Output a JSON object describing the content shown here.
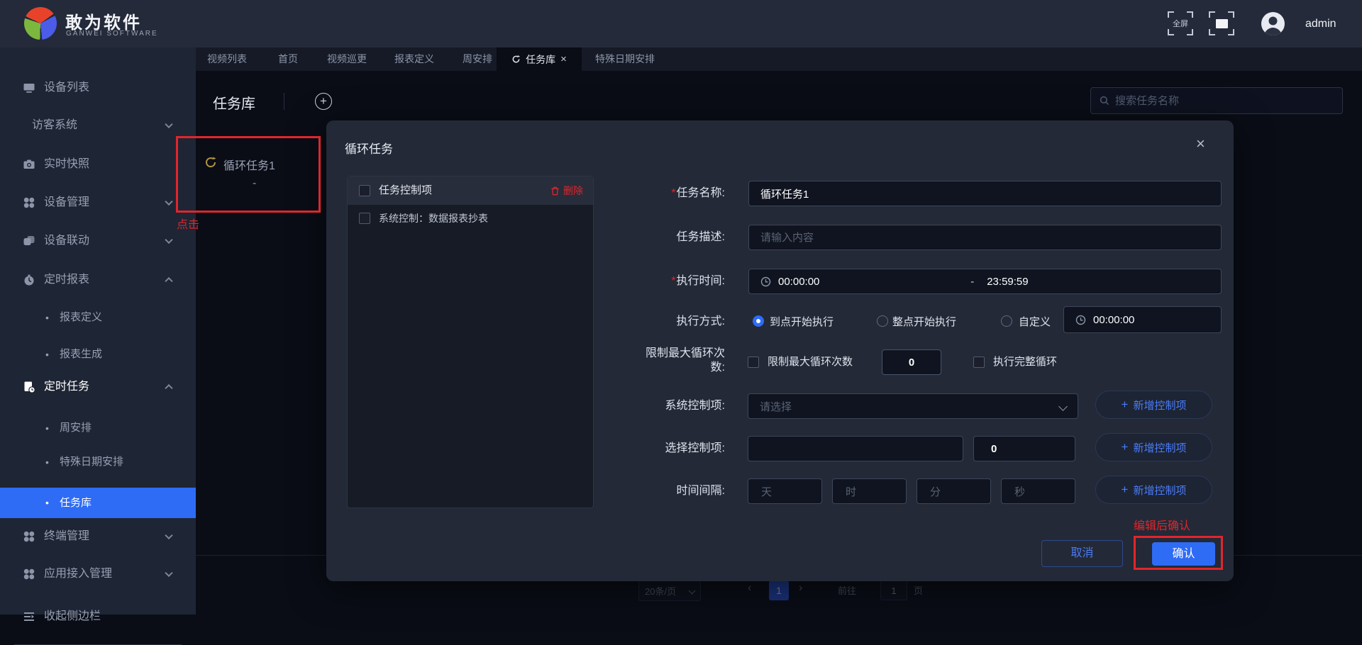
{
  "colors": {
    "accent_blue": "#2e6cf6",
    "alert_red": "#e0262c",
    "link_blue": "#4a7cf7",
    "loop_icon_yellow": "#b3953f"
  },
  "icons": {
    "plus": "+",
    "close": "×",
    "required": "*",
    "bullet": "•",
    "range_sep": "-",
    "prev": "‹",
    "next": "›"
  },
  "header": {
    "brand": "敢为软件",
    "brand_sub": "GANWEI  SOFTWARE",
    "fullscreen_label": "全屏",
    "username": "admin"
  },
  "tabs": [
    {
      "label": "视频列表"
    },
    {
      "label": "首页"
    },
    {
      "label": "视频巡更"
    },
    {
      "label": "报表定义"
    },
    {
      "label": "周安排"
    },
    {
      "label": "任务库",
      "active": true
    },
    {
      "label": "特殊日期安排"
    }
  ],
  "sidebar": {
    "items": [
      {
        "label": "设备列表"
      },
      {
        "label": "访客系统"
      },
      {
        "label": "实时快照"
      },
      {
        "label": "设备管理"
      },
      {
        "label": "设备联动"
      },
      {
        "label": "定时报表"
      },
      {
        "label": "报表定义"
      },
      {
        "label": "报表生成"
      },
      {
        "label": "定时任务"
      },
      {
        "label": "周安排"
      },
      {
        "label": "特殊日期安排"
      },
      {
        "label": "任务库",
        "selected": true
      },
      {
        "label": "终端管理"
      },
      {
        "label": "应用接入管理"
      }
    ],
    "collapse_label": "收起侧边栏"
  },
  "page": {
    "title": "任务库",
    "search_placeholder": "搜索任务名称"
  },
  "task_list": {
    "item_name": "循环任务1",
    "item_sub": "-",
    "annotation": "点击"
  },
  "dialog": {
    "title": "循环任务",
    "panel": {
      "header": "任务控制项",
      "delete_label": "删除",
      "row": "系统控制：数据报表抄表"
    },
    "form": {
      "task_name": {
        "label": "任务名称:",
        "value": "循环任务1"
      },
      "task_desc": {
        "label": "任务描述:",
        "placeholder": "请输入内容"
      },
      "exec_time": {
        "label": "执行时间:",
        "start": "00:00:00",
        "end": "23:59:59"
      },
      "exec_mode": {
        "label": "执行方式:",
        "option1": "到点开始执行",
        "option2": "整点开始执行",
        "option3": "自定义",
        "selected": "到点开始执行",
        "custom_time": "00:00:00"
      },
      "max_loop": {
        "label": "限制最大循环次数:",
        "checkbox1": "限制最大循环次数",
        "value": "0",
        "checkbox2": "执行完整循环"
      },
      "sys_ctrl": {
        "label": "系统控制项:",
        "placeholder": "请选择",
        "add_label": "新增控制项"
      },
      "sel_ctrl": {
        "label": "选择控制项:",
        "value2": "0",
        "add_label": "新增控制项"
      },
      "interval": {
        "label": "时间间隔:",
        "unit1": "天",
        "unit2": "时",
        "unit3": "分",
        "unit4": "秒",
        "add_label": "新增控制项"
      }
    },
    "note": "编辑后确认",
    "cancel_label": "取消",
    "confirm_label": "确认"
  },
  "pagination": {
    "page_size": "20条/页",
    "current": "1",
    "goto_label": "前往",
    "goto_value": "1",
    "unit": "页"
  }
}
